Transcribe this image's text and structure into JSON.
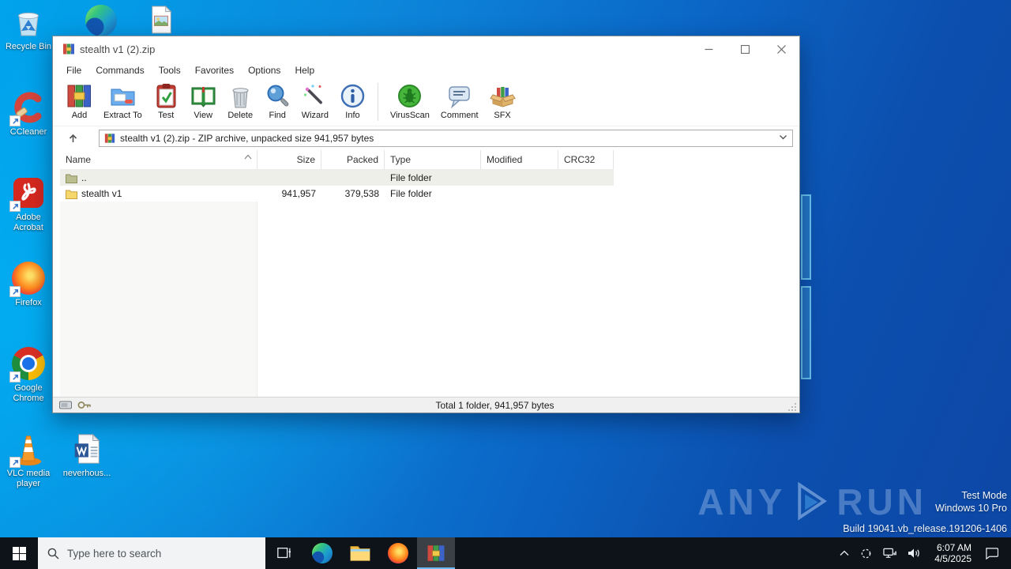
{
  "colors": {
    "accent": "#0078d7",
    "taskbar": "#0d1318",
    "active_underline": "#6cb8f0",
    "wallpaper_light": "#00a4ec",
    "wallpaper_dark": "#0d47a6",
    "updir_row": "#efefe9"
  },
  "desktop": {
    "icons": [
      {
        "label": "Recycle Bin"
      },
      {
        "label": "CCleaner"
      },
      {
        "label": "Adobe Acrobat"
      },
      {
        "label": "Firefox"
      },
      {
        "label": "Google Chrome"
      },
      {
        "label": "VLC media player"
      },
      {
        "label": "neverhous..."
      }
    ]
  },
  "window": {
    "title": "stealth v1 (2).zip",
    "menu": [
      {
        "label": "File"
      },
      {
        "label": "Commands"
      },
      {
        "label": "Tools"
      },
      {
        "label": "Favorites"
      },
      {
        "label": "Options"
      },
      {
        "label": "Help"
      }
    ],
    "toolbar": [
      {
        "label": "Add"
      },
      {
        "label": "Extract To"
      },
      {
        "label": "Test"
      },
      {
        "label": "View"
      },
      {
        "label": "Delete"
      },
      {
        "label": "Find"
      },
      {
        "label": "Wizard"
      },
      {
        "label": "Info"
      },
      {
        "label": "VirusScan"
      },
      {
        "label": "Comment"
      },
      {
        "label": "SFX"
      }
    ],
    "address": "stealth v1 (2).zip - ZIP archive, unpacked size 941,957 bytes",
    "columns": [
      {
        "label": "Name"
      },
      {
        "label": "Size"
      },
      {
        "label": "Packed"
      },
      {
        "label": "Type"
      },
      {
        "label": "Modified"
      },
      {
        "label": "CRC32"
      }
    ],
    "rows": [
      {
        "name": "..",
        "size": "",
        "packed": "",
        "type": "File folder",
        "modified": "",
        "crc32": ""
      },
      {
        "name": "stealth v1",
        "size": "941,957",
        "packed": "379,538",
        "type": "File folder",
        "modified": "",
        "crc32": ""
      }
    ],
    "status_total": "Total 1 folder, 941,957 bytes"
  },
  "taskbar": {
    "search_placeholder": "Type here to search"
  },
  "tray": {
    "time": "6:07 AM",
    "date": "4/5/2025"
  },
  "watermark": {
    "brand_left": "ANY",
    "brand_right": "RUN",
    "mode": "Test Mode",
    "os": "Windows 10 Pro",
    "build": "Build 19041.vb_release.191206-1406"
  }
}
